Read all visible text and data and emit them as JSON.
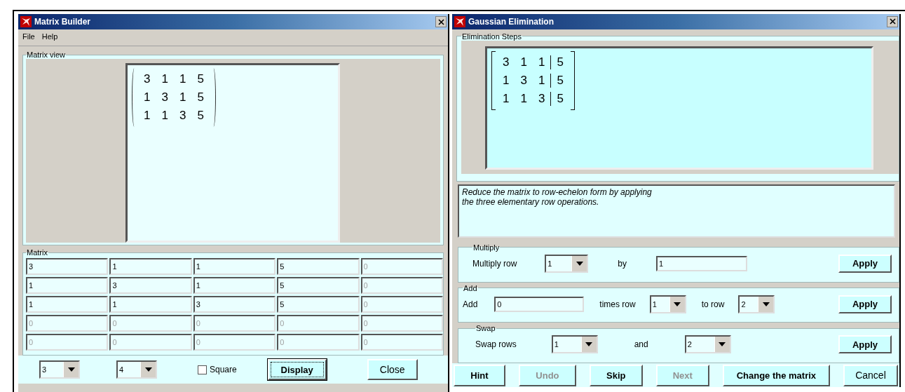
{
  "left_window": {
    "title": "Matrix Builder",
    "menu": [
      "File",
      "Help"
    ],
    "matrix_view": {
      "label": "Matrix view",
      "rows": [
        [
          "3",
          "1",
          "1",
          "5"
        ],
        [
          "1",
          "3",
          "1",
          "5"
        ],
        [
          "1",
          "1",
          "3",
          "5"
        ]
      ]
    },
    "matrix_editor": {
      "label": "Matrix",
      "rows": [
        [
          {
            "value": "3",
            "disabled": false
          },
          {
            "value": "1",
            "disabled": false
          },
          {
            "value": "1",
            "disabled": false
          },
          {
            "value": "5",
            "disabled": false
          },
          {
            "value": "0",
            "disabled": true
          }
        ],
        [
          {
            "value": "1",
            "disabled": false
          },
          {
            "value": "3",
            "disabled": false
          },
          {
            "value": "1",
            "disabled": false
          },
          {
            "value": "5",
            "disabled": false
          },
          {
            "value": "0",
            "disabled": true
          }
        ],
        [
          {
            "value": "1",
            "disabled": false
          },
          {
            "value": "1",
            "disabled": false
          },
          {
            "value": "3",
            "disabled": false
          },
          {
            "value": "5",
            "disabled": false
          },
          {
            "value": "0",
            "disabled": true
          }
        ],
        [
          {
            "value": "0",
            "disabled": true
          },
          {
            "value": "0",
            "disabled": true
          },
          {
            "value": "0",
            "disabled": true
          },
          {
            "value": "0",
            "disabled": true
          },
          {
            "value": "0",
            "disabled": true
          }
        ],
        [
          {
            "value": "0",
            "disabled": true
          },
          {
            "value": "0",
            "disabled": true
          },
          {
            "value": "0",
            "disabled": true
          },
          {
            "value": "0",
            "disabled": true
          },
          {
            "value": "0",
            "disabled": true
          }
        ]
      ]
    },
    "rows_select": "3",
    "columns_select": "4",
    "square": {
      "label": "Square",
      "checked": false
    },
    "buttons": [
      {
        "label": "Display",
        "kind": "bold",
        "focused": true
      },
      {
        "label": "Close",
        "kind": "plain",
        "focused": false
      }
    ]
  },
  "right_window": {
    "title": "Gaussian Elimination",
    "steps": {
      "label": "Elimination Steps",
      "augmented": true,
      "rows": [
        [
          "3",
          "1",
          "1",
          "5"
        ],
        [
          "1",
          "3",
          "1",
          "5"
        ],
        [
          "1",
          "1",
          "3",
          "5"
        ]
      ]
    },
    "instructions": [
      "Reduce the matrix to row-echelon form by applying",
      "the three elementary row operations."
    ],
    "multiply": {
      "label": "Multiply",
      "row_label": "Multiply row",
      "row": "1",
      "by_label": "by",
      "factor": "1",
      "apply": "Apply"
    },
    "add": {
      "label": "Add",
      "add_label": "Add",
      "factor": "0",
      "times_label": "times row",
      "from_row": "1",
      "to_label": "to row",
      "to_row": "2",
      "apply": "Apply"
    },
    "swap": {
      "label": "Swap",
      "swap_label": "Swap rows",
      "row_a": "1",
      "and_label": "and",
      "row_b": "2",
      "apply": "Apply"
    },
    "buttons": [
      {
        "label": "Hint",
        "kind": "bold",
        "disabled": false
      },
      {
        "label": "Undo",
        "kind": "bold",
        "disabled": true
      },
      {
        "label": "Skip",
        "kind": "bold",
        "disabled": false
      },
      {
        "label": "Next",
        "kind": "bold",
        "disabled": true
      },
      {
        "label": "Change the matrix",
        "kind": "bold",
        "disabled": false
      },
      {
        "label": "Cancel",
        "kind": "plain",
        "disabled": false
      }
    ]
  }
}
